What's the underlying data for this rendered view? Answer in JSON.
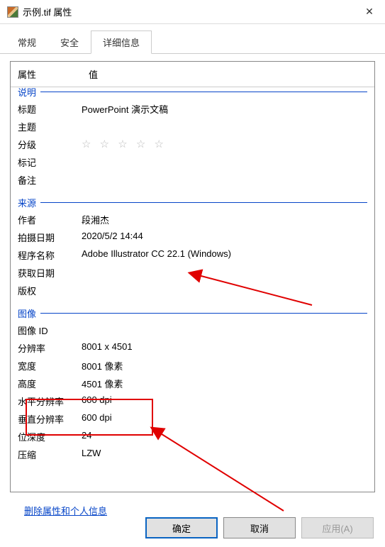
{
  "window_title": "示例.tif 属性",
  "tabs": {
    "general": "常规",
    "security": "安全",
    "details": "详细信息"
  },
  "header": {
    "property": "属性",
    "value": "值"
  },
  "sections": {
    "description": {
      "label": "说明",
      "rows": {
        "title": {
          "k": "标题",
          "v": "PowerPoint 演示文稿"
        },
        "subject": {
          "k": "主题",
          "v": ""
        },
        "rating": {
          "k": "分级",
          "v": "☆ ☆ ☆ ☆ ☆"
        },
        "tags": {
          "k": "标记",
          "v": ""
        },
        "notes": {
          "k": "备注",
          "v": ""
        }
      }
    },
    "origin": {
      "label": "来源",
      "rows": {
        "author": {
          "k": "作者",
          "v": "段湘杰"
        },
        "taken": {
          "k": "拍摄日期",
          "v": "2020/5/2 14:44"
        },
        "program": {
          "k": "程序名称",
          "v": "Adobe Illustrator CC 22.1 (Windows)"
        },
        "acquired": {
          "k": "获取日期",
          "v": ""
        },
        "copyright": {
          "k": "版权",
          "v": ""
        }
      }
    },
    "image": {
      "label": "图像",
      "rows": {
        "imageid": {
          "k": "图像 ID",
          "v": ""
        },
        "res": {
          "k": "分辨率",
          "v": "8001 x 4501"
        },
        "width": {
          "k": "宽度",
          "v": "8001 像素"
        },
        "height": {
          "k": "高度",
          "v": "4501 像素"
        },
        "hres": {
          "k": "水平分辨率",
          "v": "600 dpi"
        },
        "vres": {
          "k": "垂直分辨率",
          "v": "600 dpi"
        },
        "bits": {
          "k": "位深度",
          "v": "24"
        },
        "comp": {
          "k": "压缩",
          "v": "LZW"
        }
      }
    }
  },
  "link_text": "删除属性和个人信息",
  "buttons": {
    "ok": "确定",
    "cancel": "取消",
    "apply": "应用(A)"
  },
  "annot_color": "#e00000"
}
